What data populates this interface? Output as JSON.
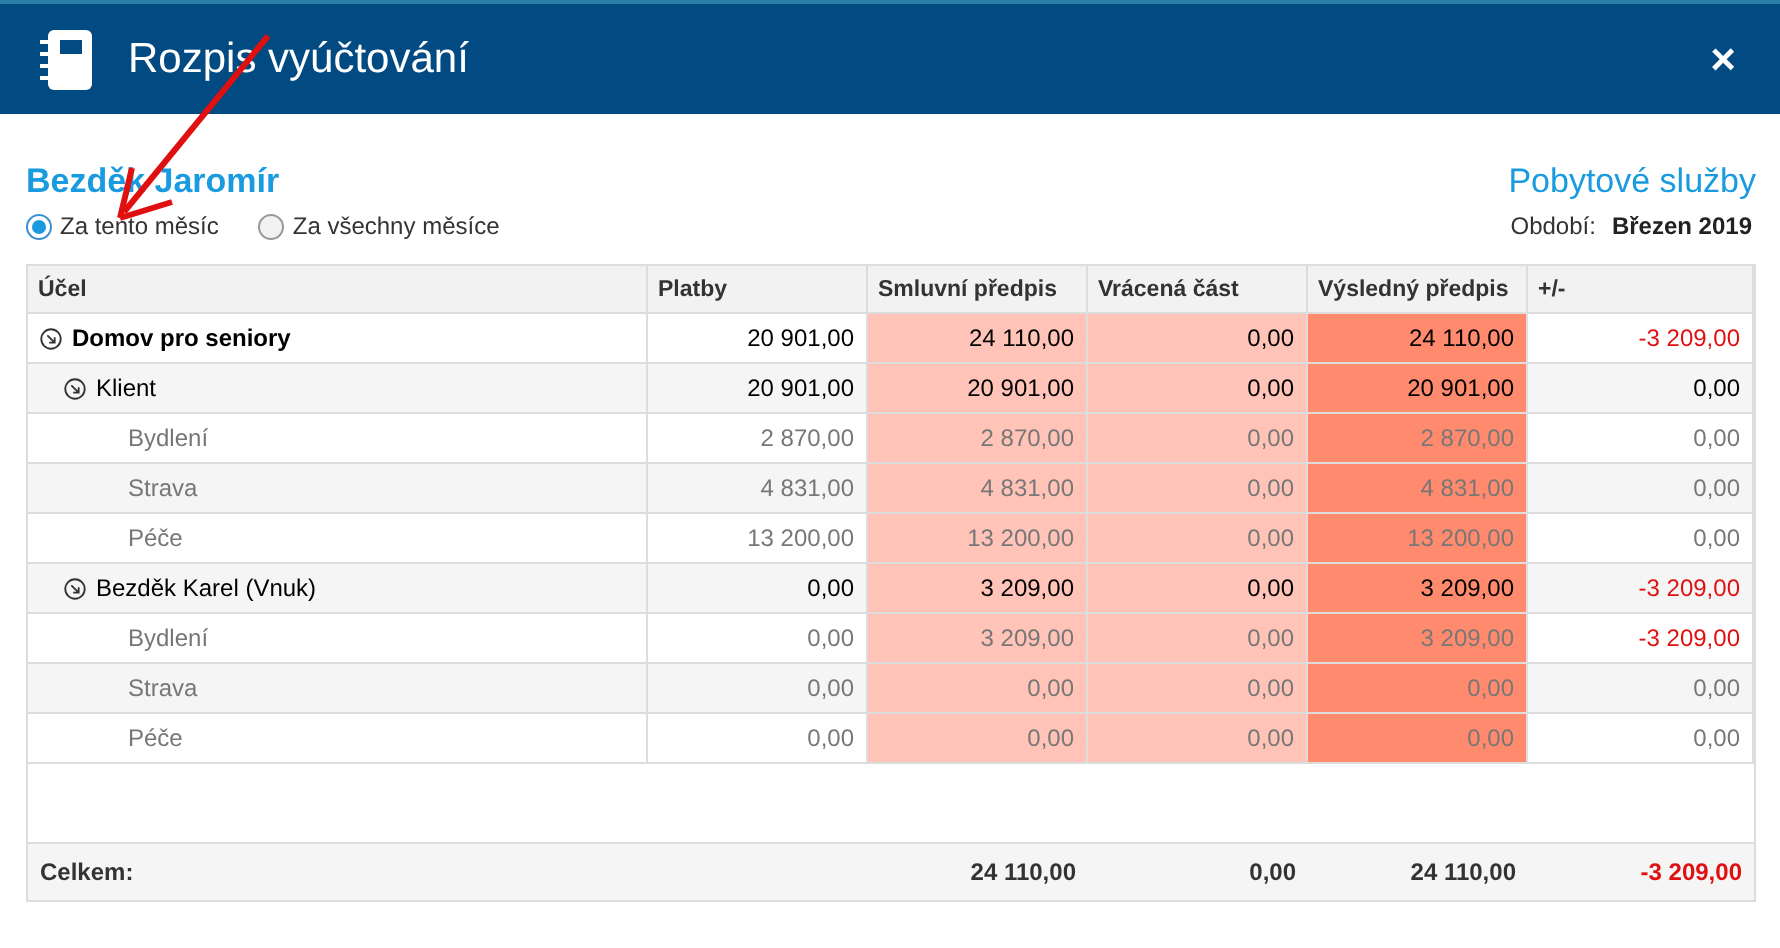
{
  "window": {
    "title": "Rozpis vyúčtování",
    "close_label": "×"
  },
  "person": "Bezděk Jaromír",
  "service": "Pobytové služby",
  "period_options": [
    {
      "label": "Za tento měsíc",
      "selected": true
    },
    {
      "label": "Za všechny měsíce",
      "selected": false
    }
  ],
  "period": {
    "label": "Období:",
    "value": "Březen 2019"
  },
  "table": {
    "columns": [
      "Účel",
      "Platby",
      "Smluvní předpis",
      "Vrácená část",
      "Výsledný předpis",
      "+/-"
    ],
    "rows": [
      {
        "kind": "group",
        "name": "Domov pro seniory",
        "expanded": true,
        "values": [
          "20 901,00",
          "24 110,00",
          "0,00",
          "24 110,00",
          "-3 209,00"
        ],
        "negative": true,
        "children": [
          {
            "kind": "subgroup",
            "name": "Klient",
            "expanded": true,
            "values": [
              "20 901,00",
              "20 901,00",
              "0,00",
              "20 901,00",
              "0,00"
            ],
            "negative": false,
            "children": [
              {
                "kind": "item",
                "name": "Bydlení",
                "values": [
                  "2 870,00",
                  "2 870,00",
                  "0,00",
                  "2 870,00",
                  "0,00"
                ],
                "negative": false
              },
              {
                "kind": "item",
                "name": "Strava",
                "values": [
                  "4 831,00",
                  "4 831,00",
                  "0,00",
                  "4 831,00",
                  "0,00"
                ],
                "negative": false
              },
              {
                "kind": "item",
                "name": "Péče",
                "values": [
                  "13 200,00",
                  "13 200,00",
                  "0,00",
                  "13 200,00",
                  "0,00"
                ],
                "negative": false
              }
            ]
          },
          {
            "kind": "subgroup",
            "name": "Bezděk Karel (Vnuk)",
            "expanded": true,
            "values": [
              "0,00",
              "3 209,00",
              "0,00",
              "3 209,00",
              "-3 209,00"
            ],
            "negative": true,
            "children": [
              {
                "kind": "item",
                "name": "Bydlení",
                "values": [
                  "0,00",
                  "3 209,00",
                  "0,00",
                  "3 209,00",
                  "-3 209,00"
                ],
                "negative": true
              },
              {
                "kind": "item",
                "name": "Strava",
                "values": [
                  "0,00",
                  "0,00",
                  "0,00",
                  "0,00",
                  "0,00"
                ],
                "negative": false
              },
              {
                "kind": "item",
                "name": "Péče",
                "values": [
                  "0,00",
                  "0,00",
                  "0,00",
                  "0,00",
                  "0,00"
                ],
                "negative": false
              }
            ]
          }
        ]
      }
    ],
    "total": {
      "label": "Celkem:",
      "values": [
        "24 110,00",
        "0,00",
        "24 110,00",
        "-3 209,00"
      ],
      "negative": true
    }
  }
}
